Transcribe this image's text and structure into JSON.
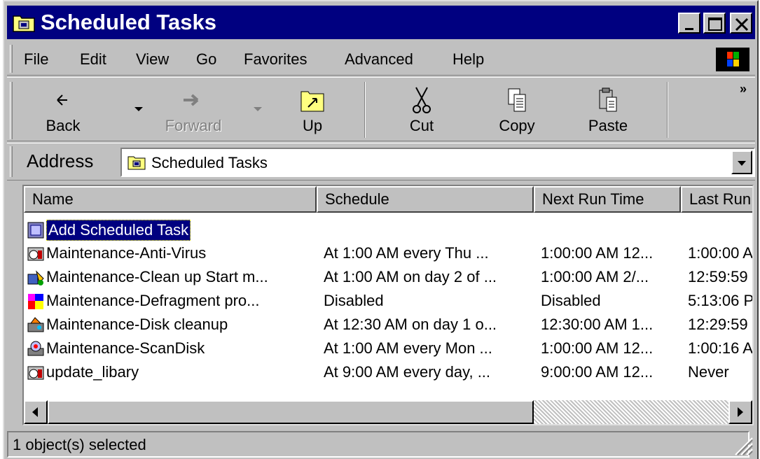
{
  "window": {
    "title": "Scheduled Tasks",
    "icon": "scheduled-tasks-folder-icon",
    "controls": [
      "minimize-icon",
      "maximize-icon",
      "close-icon"
    ]
  },
  "menu": {
    "items": [
      "File",
      "Edit",
      "View",
      "Go",
      "Favorites",
      "Advanced",
      "Help"
    ]
  },
  "toolbar": {
    "back_label": "Back",
    "forward_label": "Forward",
    "up_label": "Up",
    "cut_label": "Cut",
    "copy_label": "Copy",
    "paste_label": "Paste",
    "more_label": "»"
  },
  "address": {
    "label": "Address",
    "value": "Scheduled Tasks"
  },
  "list": {
    "columns": [
      "Name",
      "Schedule",
      "Next Run Time",
      "Last Run"
    ],
    "rows": [
      {
        "name": "Add Scheduled Task",
        "schedule": "",
        "next": "",
        "last": "",
        "selected": true,
        "icon": "add-task-icon"
      },
      {
        "name": "Maintenance-Anti-Virus",
        "schedule": "At 1:00 AM every Thu ...",
        "next": "1:00:00 AM  12...",
        "last": "1:00:00 A",
        "icon": "task-icon"
      },
      {
        "name": "Maintenance-Clean up Start m...",
        "schedule": "At 1:00 AM on day 2 of ...",
        "next": "1:00:00 AM  2/...",
        "last": "12:59:59 ,",
        "icon": "cleanup-task-icon"
      },
      {
        "name": "Maintenance-Defragment pro...",
        "schedule": "Disabled",
        "next": "Disabled",
        "last": "5:13:06 P",
        "icon": "defrag-task-icon"
      },
      {
        "name": "Maintenance-Disk cleanup",
        "schedule": "At 12:30 AM on day 1 o...",
        "next": "12:30:00 AM  1...",
        "last": "12:29:59 ,",
        "icon": "disk-cleanup-task-icon"
      },
      {
        "name": "Maintenance-ScanDisk",
        "schedule": "At 1:00 AM every Mon ...",
        "next": "1:00:00 AM  12...",
        "last": "1:00:16 A",
        "icon": "scandisk-task-icon"
      },
      {
        "name": "update_libary",
        "schedule": "At 9:00 AM every day, ...",
        "next": "9:00:00 AM  12...",
        "last": "Never",
        "icon": "task-icon"
      }
    ]
  },
  "status": {
    "text": "1 object(s) selected"
  }
}
